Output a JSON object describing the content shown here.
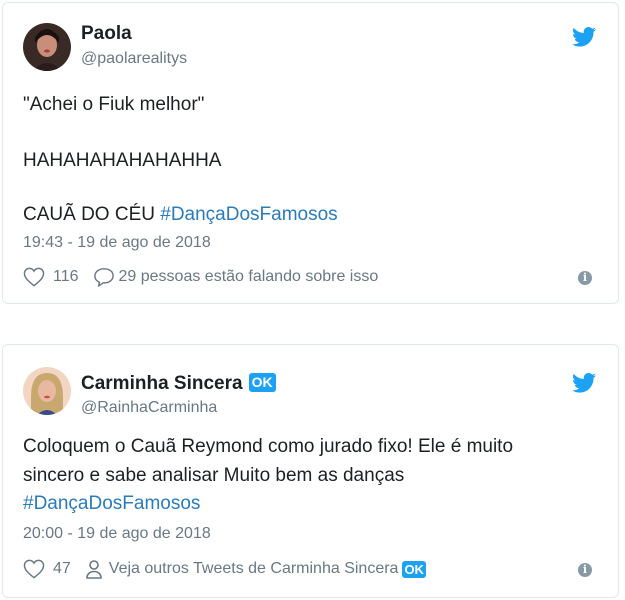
{
  "tweets": [
    {
      "name": "Paola",
      "handle": "@paolarealitys",
      "paragraphs": [
        "\"Achei o Fiuk melhor\"",
        "HAHAHAHAHAHAHHA",
        "CAUÃ DO CÉU"
      ],
      "hashtag": "#DançaDosFamosos",
      "timestamp": "19:43 - 19 de ago de 2018",
      "likes": "116",
      "reply_text": "29 pessoas estão falando sobre isso",
      "icons": [
        "avatar",
        "twitter-bird-icon",
        "heart-icon",
        "reply-bubble-icon",
        "info-icon"
      ]
    },
    {
      "name": "Carminha Sincera",
      "badge": "OK",
      "handle": "@RainhaCarminha",
      "lines": [
        "Coloquem o Cauã Reymond como jurado fixo! Ele é muito",
        "sincero e sabe analisar Muito bem as danças"
      ],
      "hashtag": "#DançaDosFamosos",
      "timestamp": "20:00 - 19 de ago de 2018",
      "likes": "47",
      "more_text": "Veja outros Tweets de Carminha Sincera",
      "icons": [
        "avatar",
        "twitter-bird-icon",
        "heart-icon",
        "person-icon",
        "info-icon"
      ]
    }
  ],
  "colors": {
    "text": "#1c2022",
    "muted": "#697882",
    "link": "#2b7bb9",
    "twitter_blue": "#1da1f2",
    "border": "#e1e8ed"
  }
}
